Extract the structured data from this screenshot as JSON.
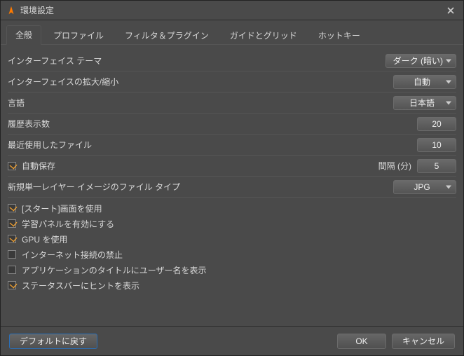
{
  "window": {
    "title": "環境設定",
    "icon": "app-icon"
  },
  "tabs": [
    {
      "label": "全般",
      "active": true
    },
    {
      "label": "プロファイル",
      "active": false
    },
    {
      "label": "フィルタ＆プラグイン",
      "active": false
    },
    {
      "label": "ガイドとグリッド",
      "active": false
    },
    {
      "label": "ホットキー",
      "active": false
    }
  ],
  "settings": {
    "theme": {
      "label": "インターフェイス テーマ",
      "value": "ダーク (暗い)"
    },
    "scale": {
      "label": "インターフェイスの拡大/縮小",
      "value": "自動"
    },
    "language": {
      "label": "言語",
      "value": "日本語"
    },
    "history": {
      "label": "履歴表示数",
      "value": "20"
    },
    "recent": {
      "label": "最近使用したファイル",
      "value": "10"
    },
    "autosave": {
      "label": "自動保存",
      "checked": true,
      "interval_label": "間隔 (分)",
      "interval_value": "5"
    },
    "newlayer": {
      "label": "新規単一レイヤー イメージのファイル タイプ",
      "value": "JPG"
    }
  },
  "checks": [
    {
      "label": "[スタート]画面を使用",
      "checked": true
    },
    {
      "label": "学習パネルを有効にする",
      "checked": true
    },
    {
      "label": "GPU を使用",
      "checked": true
    },
    {
      "label": "インターネット接続の禁止",
      "checked": false
    },
    {
      "label": "アプリケーションのタイトルにユーザー名を表示",
      "checked": false
    },
    {
      "label": "ステータスバーにヒントを表示",
      "checked": true
    }
  ],
  "footer": {
    "restore": "デフォルトに戻す",
    "ok": "OK",
    "cancel": "キャンセル"
  }
}
